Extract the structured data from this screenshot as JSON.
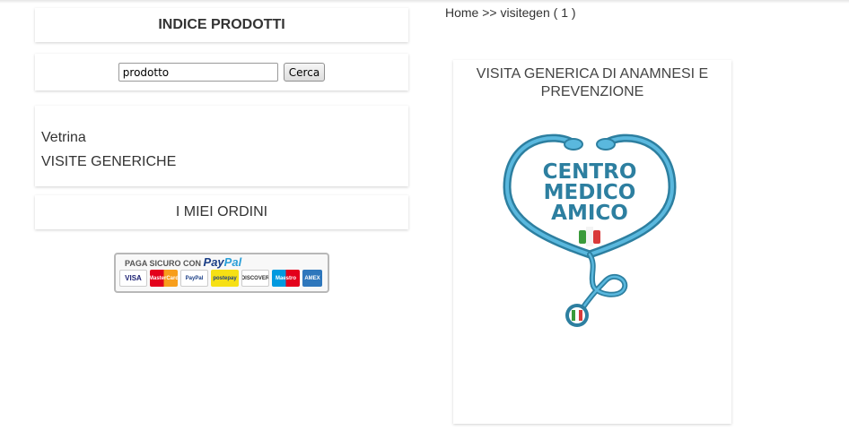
{
  "sidebar": {
    "index_title": "INDICE PRODOTTI",
    "search": {
      "value": "prodotto",
      "button_label": "Cerca"
    },
    "categories": [
      {
        "label": "Vetrina"
      },
      {
        "label": "VISITE GENERICHE"
      }
    ],
    "orders_label": "I MIEI ORDINI",
    "paypal": {
      "heading": "PAGA SICURO CON",
      "brand_pay": "Pay",
      "brand_pal": "Pal",
      "cards": [
        "VISA",
        "MasterCard",
        "PayPal",
        "postepay",
        "DISCOVER",
        "Maestro",
        "AMEX"
      ]
    }
  },
  "breadcrumb": {
    "home": "Home",
    "separator": ">>",
    "current": "visitegen",
    "count": "( 1 )"
  },
  "product": {
    "title": "VISITA GENERICA DI ANAMNESI E PREVENZIONE",
    "logo": {
      "line1": "CENTRO",
      "line2": "MEDICO",
      "line3": "AMICO",
      "icon": "stethoscope-heart-icon"
    }
  },
  "colors": {
    "logo_blue": "#2d7fa0",
    "logo_light_blue": "#5ab8de",
    "italy_green": "#3a9a3a",
    "italy_red": "#d93a3a"
  }
}
